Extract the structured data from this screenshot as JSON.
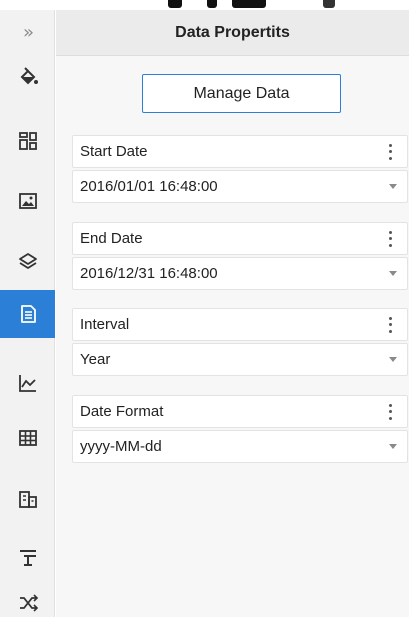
{
  "panel": {
    "title": "Data Propertits",
    "manage_button_label": "Manage Data"
  },
  "rail": {
    "expand_glyph": "»",
    "items": [
      {
        "name": "fill-icon",
        "active": false
      },
      {
        "name": "layout-grid-icon",
        "active": false
      },
      {
        "name": "image-icon",
        "active": false
      },
      {
        "name": "layers-icon",
        "active": false
      },
      {
        "name": "data-document-icon",
        "active": true
      },
      {
        "name": "line-chart-icon",
        "active": false
      },
      {
        "name": "table-icon",
        "active": false
      },
      {
        "name": "building-icon",
        "active": false
      },
      {
        "name": "text-align-icon",
        "active": false
      },
      {
        "name": "shuffle-icon",
        "active": false
      }
    ]
  },
  "properties": [
    {
      "label": "Start Date",
      "value": "2016/01/01 16:48:00"
    },
    {
      "label": "End Date",
      "value": "2016/12/31 16:48:00"
    },
    {
      "label": "Interval",
      "value": "Year"
    },
    {
      "label": "Date Format",
      "value": "yyyy-MM-dd"
    }
  ],
  "colors": {
    "accent": "#2b7fd6",
    "rail_bg": "#f2f2f2",
    "panel_bg": "#f7f7f7",
    "header_bg": "#ebebeb"
  }
}
